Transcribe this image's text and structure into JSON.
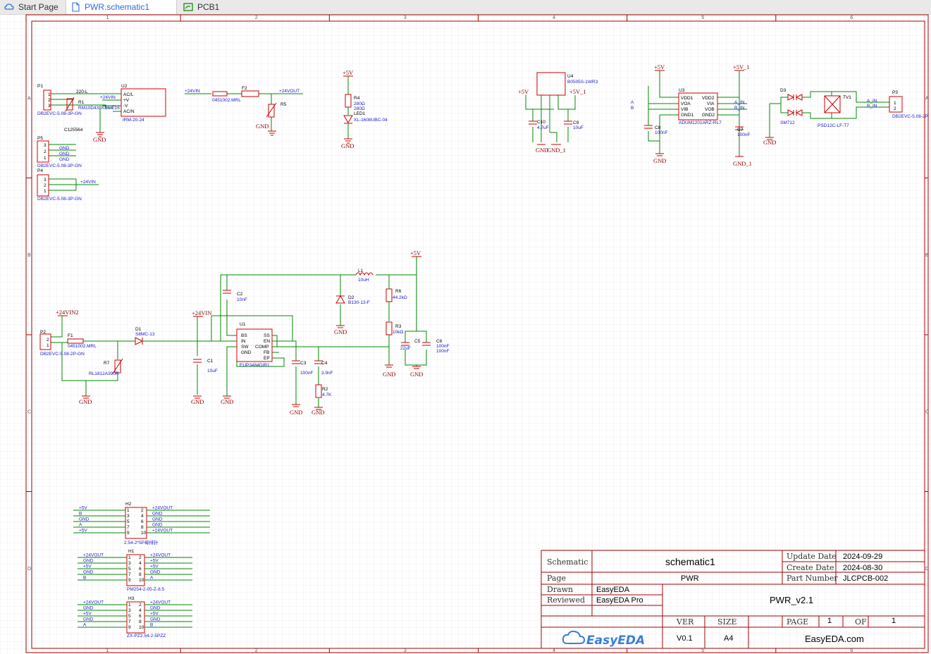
{
  "tabs": {
    "start_page": "Start Page",
    "schematic": "PWR.schematic1",
    "pcb": "PCB1"
  },
  "title_block": {
    "schematic_label": "Schematic",
    "schematic_value": "schematic1",
    "page_label": "Page",
    "page_value": "PWR",
    "drawn_label": "Drawn",
    "drawn_value": "EasyEDA",
    "reviewed_label": "Reviewed",
    "reviewed_value": "EasyEDA Pro",
    "update_date_label": "Update Date",
    "update_date_value": "2024-09-29",
    "create_date_label": "Create Date",
    "create_date_value": "2024-08-30",
    "part_number_label": "Part Number",
    "part_number_value": "JLCPCB-002",
    "project_name": "PWR_v2.1",
    "ver_label": "VER",
    "ver_value": "V0.1",
    "size_label": "SIZE",
    "size_value": "A4",
    "page_no_label": "PAGE",
    "page_no_value": "1",
    "of_label": "OF",
    "of_value": "1",
    "logo_text": "EasyEDA",
    "site": "EasyEDA.com"
  },
  "border": {
    "columns": [
      "1",
      "2",
      "3",
      "4",
      "5",
      "6"
    ],
    "rows": [
      "A",
      "B",
      "C",
      "D"
    ]
  },
  "components": {
    "p1": {
      "ref": "P1",
      "value": "DB2EVC-5.08-3P-GN"
    },
    "r1": {
      "ref": "R1",
      "value": "RM10D431KD1IE16",
      "extra": "220-L"
    },
    "u_irm": {
      "ref": "U2",
      "value": "IRM-20-24",
      "pins": [
        "AC/L",
        "+V",
        "-V",
        "AC/N"
      ]
    },
    "c125564": "C125564",
    "p5": {
      "ref": "P5",
      "value": "DB2EVC-5.08-3P-GN"
    },
    "p4": {
      "ref": "P4",
      "value": "DB2EVC-5.08-3P-GN"
    },
    "f2": {
      "ref": "F2",
      "value": "0451002.MRL"
    },
    "r5": {
      "ref": "R5"
    },
    "r4": {
      "ref": "R4",
      "value": "280Ω",
      "value2": "280Ω"
    },
    "led1": {
      "ref": "LED1",
      "value": "XL-1608UBC-04"
    },
    "u4": {
      "ref": "U4",
      "value": "B0505S-1WR3"
    },
    "c10": {
      "ref": "C10",
      "value": "4.7uF"
    },
    "c9": {
      "ref": "C9",
      "value": "10uF"
    },
    "u3": {
      "ref": "U3",
      "value": "ADUM1201ARZ-RL7",
      "pins_left": [
        "VDD1",
        "VOA",
        "VIB",
        "GND1"
      ],
      "pins_right": [
        "VDD2",
        "VIA",
        "VOB",
        "GND2"
      ]
    },
    "c8": {
      "ref": "C8",
      "value": "100nF"
    },
    "c7": {
      "ref": "C7",
      "value": "100nF"
    },
    "d3": {
      "ref": "D3",
      "value": "SM712"
    },
    "tv1": {
      "ref": "TV1",
      "value": "PSD12C-LF-T7"
    },
    "p3": {
      "ref": "P3",
      "value": "DB2EVC-5.08-2P"
    },
    "l1": {
      "ref": "L1",
      "value": "10uH"
    },
    "c2": {
      "ref": "C2",
      "value": "10nF"
    },
    "d2": {
      "ref": "D2",
      "value": "B130-13-F"
    },
    "r6": {
      "ref": "R6",
      "value": "44.2kΩ"
    },
    "r3": {
      "ref": "R3",
      "value": "10kΩ"
    },
    "c5": {
      "ref": "C5",
      "value": "22uF"
    },
    "c6": {
      "ref": "C6",
      "value": "100nF",
      "value2": "100nF"
    },
    "p2": {
      "ref": "P2",
      "value": "DB2EVC-5.08-2P-GN"
    },
    "f1": {
      "value": "0451002.MRL"
    },
    "d1": {
      "ref": "D1",
      "value": "S8MC-13"
    },
    "r7": {
      "ref": "R7",
      "value": "RL1812A390R"
    },
    "c1": {
      "ref": "C1",
      "value": "10uF"
    },
    "u1": {
      "ref": "U1",
      "value": "EUP3484DIR1",
      "pins_left": [
        "BS",
        "IN",
        "SW",
        "GND"
      ],
      "pins_right": [
        "SS",
        "EN",
        "COMP",
        "FB",
        "EP"
      ]
    },
    "c3": {
      "ref": "C3",
      "value": "100nF"
    },
    "c4": {
      "ref": "C4",
      "value": "3.9nF"
    },
    "r2": {
      "ref": "R2",
      "value": "4.7K"
    },
    "h2": {
      "ref": "H2",
      "value": "2.54-2*5P母排针",
      "left": [
        "+5V",
        "B",
        "GND",
        "A",
        "+5V"
      ],
      "right": [
        "+24VOUT",
        "GND",
        "GND",
        "GND",
        "+24VOUT"
      ]
    },
    "h1": {
      "ref": "H1",
      "value": "PM254-2-05-Z-8.5",
      "left": [
        "+24VOUT",
        "GND",
        "+5V",
        "GND",
        "B"
      ],
      "right": [
        "+24VOUT",
        "+5V",
        "+5V",
        "GND",
        "A"
      ]
    },
    "h3": {
      "ref": "H3",
      "value": "ZX-PZ2.54-2-5PZZ",
      "left": [
        "+24VOUT",
        "GND",
        "+5V",
        "GND",
        "A"
      ],
      "right": [
        "+24VOUT",
        "GND",
        "+5V",
        "GND",
        "B"
      ]
    }
  },
  "nets": {
    "gnd": "GND",
    "gnd_1": "GND_1",
    "p5v": "+5V",
    "p5v_1": "+5V_1",
    "p24vin": "+24VIN",
    "p24vin2": "+24VIN2",
    "p24vout": "+24VOUT",
    "a": "A",
    "b": "B",
    "a_in": "A_IN",
    "b_in": "B_IN"
  },
  "colors": {
    "grid": "#e2e2e2",
    "border": "#a00000",
    "part": "#cc0000",
    "wire": "#008800",
    "label": "#1a1ad0",
    "active_tab": "#2a6fd6"
  }
}
